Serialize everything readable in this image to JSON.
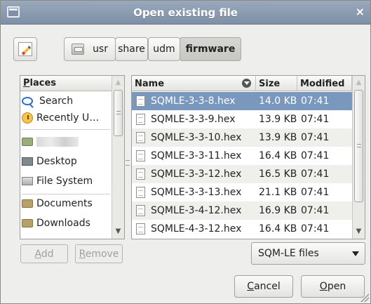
{
  "window": {
    "title": "Open existing file"
  },
  "pathbar": {
    "segments": [
      "usr",
      "share",
      "udm",
      "firmware"
    ]
  },
  "places": {
    "header": "Places",
    "items": [
      "Search",
      "Recently U…",
      "",
      "Desktop",
      "File System",
      "Documents",
      "Downloads"
    ]
  },
  "files": {
    "columns": {
      "name": "Name",
      "size": "Size",
      "modified": "Modified"
    },
    "rows": [
      {
        "name": "SQMLE-3-3-8.hex",
        "size": "14.0 KB",
        "modified": "07:41"
      },
      {
        "name": "SQMLE-3-3-9.hex",
        "size": "13.9 KB",
        "modified": "07:41"
      },
      {
        "name": "SQMLE-3-3-10.hex",
        "size": "13.9 KB",
        "modified": "07:41"
      },
      {
        "name": "SQMLE-3-3-11.hex",
        "size": "16.4 KB",
        "modified": "07:41"
      },
      {
        "name": "SQMLE-3-3-12.hex",
        "size": "16.5 KB",
        "modified": "07:41"
      },
      {
        "name": "SQMLE-3-3-13.hex",
        "size": "21.1 KB",
        "modified": "07:41"
      },
      {
        "name": "SQMLE-3-4-12.hex",
        "size": "16.9 KB",
        "modified": "07:41"
      },
      {
        "name": "SQMLE-4-3-12.hex",
        "size": "16.4 KB",
        "modified": "07:41"
      }
    ]
  },
  "buttons": {
    "add": "Add",
    "remove": "Remove",
    "cancel": "Cancel",
    "open": "Open"
  },
  "filter": {
    "selected": "SQM-LE files"
  }
}
